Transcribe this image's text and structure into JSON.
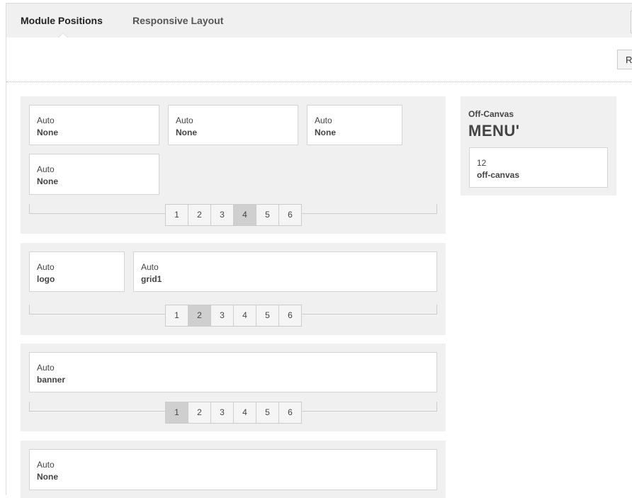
{
  "tabs": [
    {
      "label": "Module Positions",
      "active": true
    },
    {
      "label": "Responsive Layout",
      "active": false
    }
  ],
  "toolbar": {
    "r_button_label": "R"
  },
  "rows": [
    {
      "modules": [
        {
          "width": "Auto",
          "name": "None"
        },
        {
          "width": "Auto",
          "name": "None"
        },
        {
          "width": "Auto",
          "name": "None"
        },
        {
          "width": "Auto",
          "name": "None"
        }
      ],
      "pager": [
        "1",
        "2",
        "3",
        "4",
        "5",
        "6"
      ],
      "selected": "4"
    },
    {
      "modules": [
        {
          "width": "Auto",
          "name": "logo"
        },
        {
          "width": "Auto",
          "name": "grid1"
        }
      ],
      "pager": [
        "1",
        "2",
        "3",
        "4",
        "5",
        "6"
      ],
      "selected": "2"
    },
    {
      "modules": [
        {
          "width": "Auto",
          "name": "banner"
        }
      ],
      "pager": [
        "1",
        "2",
        "3",
        "4",
        "5",
        "6"
      ],
      "selected": "1"
    },
    {
      "modules": [
        {
          "width": "Auto",
          "name": "None"
        }
      ]
    }
  ],
  "offcanvas": {
    "label": "Off-Canvas",
    "title": "MENU'",
    "module": {
      "width": "12",
      "name": "off-canvas"
    }
  },
  "colors": {
    "row_bg": "#f0f0f0",
    "selected_page": "#cfcfcf"
  }
}
